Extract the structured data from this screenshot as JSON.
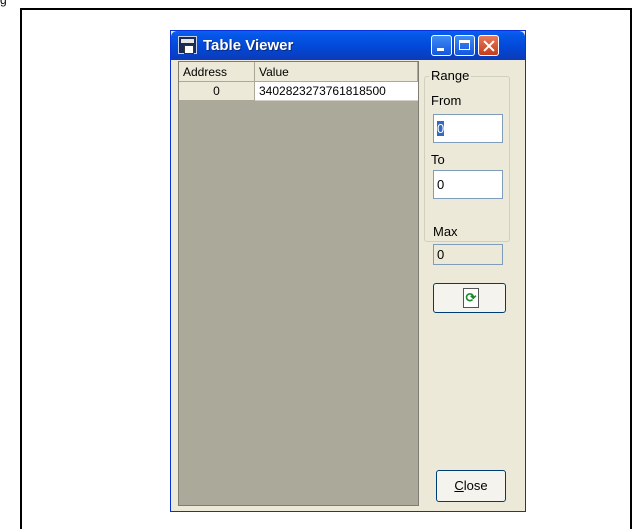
{
  "top_caption": "g",
  "window": {
    "title": "Table Viewer",
    "icons": {
      "app": "table-viewer-app-icon",
      "minimize": "minimize-icon",
      "maximize": "maximize-icon",
      "close": "close-icon"
    }
  },
  "table": {
    "columns": [
      "Address",
      "Value"
    ],
    "rows": [
      {
        "address": "0",
        "value": "3402823273761818500"
      }
    ]
  },
  "range": {
    "title": "Range",
    "from_label": "From",
    "from_value": "0",
    "to_label": "To",
    "to_value": "0"
  },
  "max": {
    "label": "Max",
    "value": "0"
  },
  "refresh": {
    "icon": "refresh-icon",
    "glyph": "⟳"
  },
  "close_button": {
    "label": "Close",
    "mnemonic": "C",
    "rest": "lose"
  },
  "colors": {
    "titlebar": "#0348d8",
    "window_bg": "#ece9d8",
    "grid_bg": "#aaa99a"
  }
}
